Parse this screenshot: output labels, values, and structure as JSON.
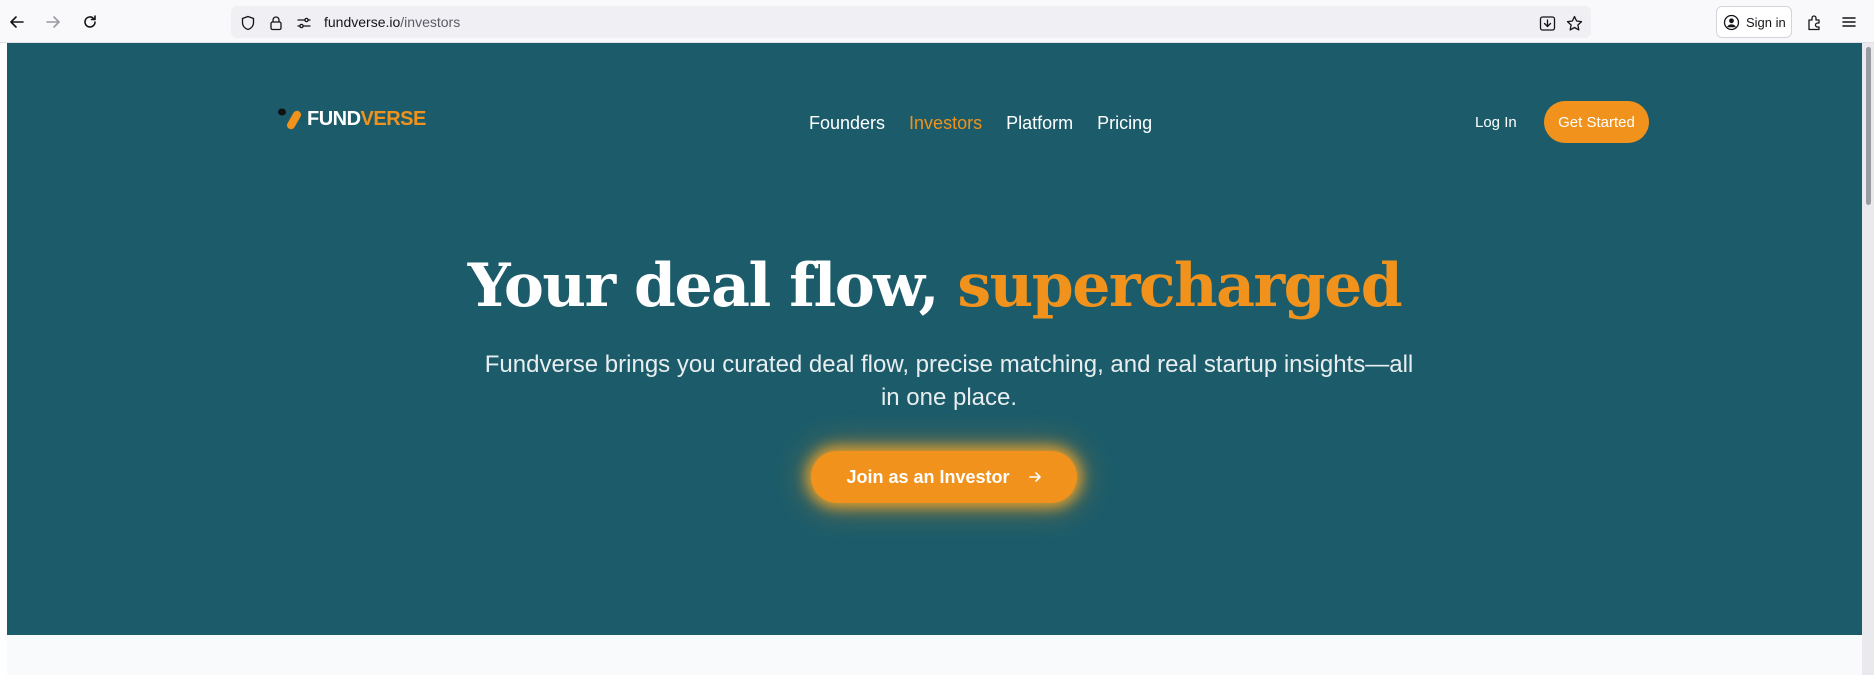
{
  "browser": {
    "url_domain": "fundverse.io",
    "url_path": "/investors",
    "sign_in_label": "Sign in",
    "icons": [
      "back-icon",
      "forward-icon",
      "reload-icon",
      "shield-icon",
      "lock-icon",
      "permissions-icon",
      "save-page-icon",
      "bookmark-star-icon",
      "account-icon",
      "extensions-icon",
      "menu-icon"
    ]
  },
  "nav": {
    "logo_part1": "FUND",
    "logo_part2": "VERSE",
    "links": [
      {
        "label": "Founders"
      },
      {
        "label": "Investors"
      },
      {
        "label": "Platform"
      },
      {
        "label": "Pricing"
      }
    ],
    "login_label": "Log In",
    "cta_label": "Get Started"
  },
  "hero": {
    "title_part1": "Your deal flow, ",
    "title_part2": "supercharged",
    "subtitle": "Fundverse brings you curated deal flow, precise matching, and real startup insights—all in one place.",
    "cta_label": "Join as an Investor",
    "cta_icon": "arrow-right-icon"
  },
  "colors": {
    "hero_bg": "#1c5c6a",
    "accent": "#f0921c",
    "text": "#ffffff"
  }
}
